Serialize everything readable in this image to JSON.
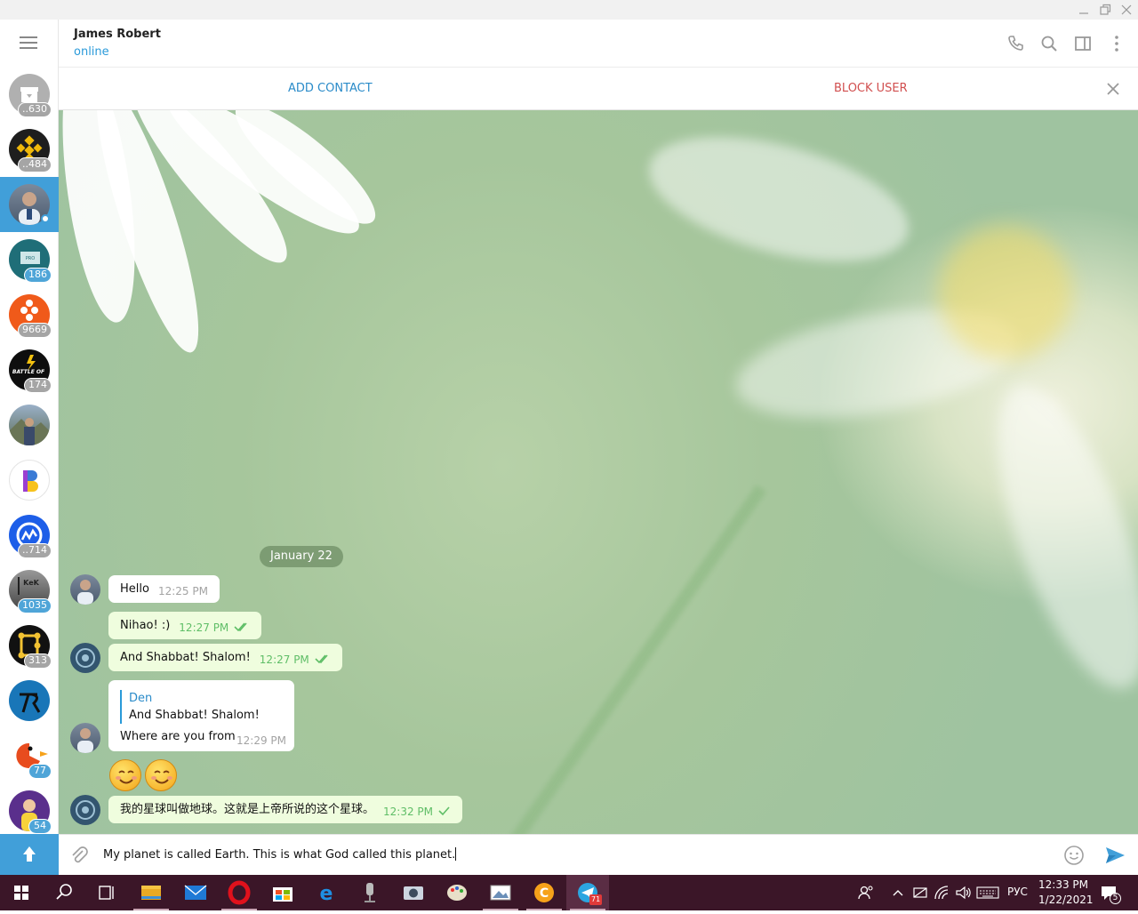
{
  "window": {
    "controls": [
      "minimize",
      "restore",
      "close"
    ]
  },
  "sidebar": {
    "chats": [
      {
        "name": "archive",
        "badge": "..630",
        "badge_style": "gray"
      },
      {
        "name": "binance",
        "badge": "..484",
        "badge_style": "gray"
      },
      {
        "name": "james-robert",
        "badge": "",
        "selected": true,
        "online": true
      },
      {
        "name": "pro-blockchain",
        "badge": "186",
        "badge_style": "blue"
      },
      {
        "name": "crypto-orange",
        "badge": "9669",
        "badge_style": "gray"
      },
      {
        "name": "battle-of-traders",
        "badge": "174",
        "badge_style": "gray"
      },
      {
        "name": "mountain-person",
        "badge": ""
      },
      {
        "name": "bitcoin-b",
        "badge": ""
      },
      {
        "name": "coinmarketcap",
        "badge": "..714",
        "badge_style": "gray"
      },
      {
        "name": "kick",
        "badge": "1035",
        "badge_style": "blue"
      },
      {
        "name": "ring-gold",
        "badge": "313",
        "badge_style": "gray"
      },
      {
        "name": "tr-logo",
        "badge": ""
      },
      {
        "name": "pacman-bird",
        "badge": "77",
        "badge_style": "blue"
      },
      {
        "name": "purple-person",
        "badge": "54",
        "badge_style": "blue"
      }
    ]
  },
  "header": {
    "name": "James Robert",
    "status": "online"
  },
  "actionbar": {
    "add_contact": "ADD CONTACT",
    "block_user": "BLOCK USER"
  },
  "chat": {
    "date": "January 22",
    "messages": [
      {
        "dir": "in",
        "text": "Hello",
        "time": "12:25 PM"
      },
      {
        "dir": "out",
        "text": "Nihao! :)",
        "time": "12:27 PM",
        "read": true
      },
      {
        "dir": "out",
        "text": "And Shabbat! Shalom!",
        "time": "12:27 PM",
        "read": true
      },
      {
        "dir": "in",
        "reply_name": "Den",
        "reply_text": "And Shabbat! Shalom!",
        "text": "Where are you from",
        "time": "12:29 PM"
      },
      {
        "dir": "in",
        "emoji": "☺☺"
      },
      {
        "dir": "out",
        "text": "我的星球叫做地球。这就是上帝所说的这个星球。",
        "time": "12:32 PM",
        "read": false
      }
    ]
  },
  "composer": {
    "text": "My planet is called Earth. This is what God called this planet."
  },
  "taskbar": {
    "apps": [
      "start",
      "search",
      "task-view",
      "file-explorer",
      "mail",
      "opera",
      "store",
      "edge",
      "microphone-app",
      "camera-app",
      "paint",
      "photos",
      "c-app",
      "telegram"
    ],
    "telegram_badge": "71",
    "lang": "РУС",
    "time": "12:33 PM",
    "date": "1/22/2021",
    "notifications": "5"
  },
  "colors": {
    "accent": "#419fd9",
    "block": "#d14f4f",
    "taskbar": "#3b1628",
    "out_bubble": "#effdde"
  }
}
